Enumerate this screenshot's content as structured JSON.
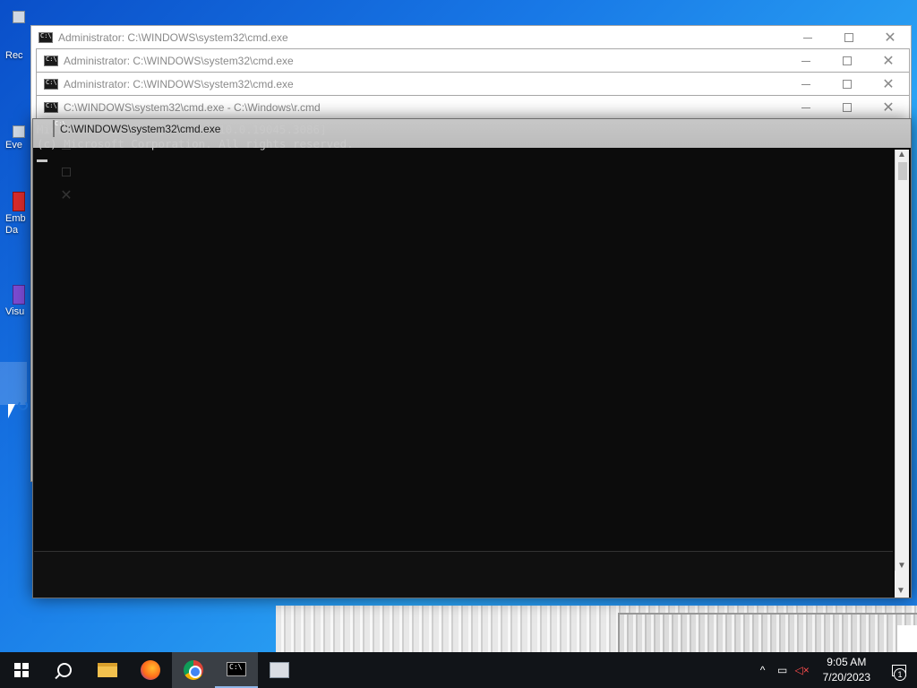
{
  "desktop": {
    "icons": [
      {
        "label": "Rec"
      },
      {
        "label": "Eve"
      },
      {
        "label": "Emb\nDa"
      },
      {
        "label": "Visu"
      }
    ]
  },
  "windows": [
    {
      "title": "Administrator: C:\\WINDOWS\\system32\\cmd.exe"
    },
    {
      "title": "Administrator: C:\\WINDOWS\\system32\\cmd.exe"
    },
    {
      "title": "Administrator: C:\\WINDOWS\\system32\\cmd.exe"
    },
    {
      "title": "C:\\WINDOWS\\system32\\cmd.exe - C:\\Windows\\r.cmd"
    }
  ],
  "main_window": {
    "title": "C:\\WINDOWS\\system32\\cmd.exe",
    "console_lines": "Microsoft Windows [Version 10.0.19045.3086]\n(c) Microsoft Corporation. All rights reserved."
  },
  "window_controls": {
    "minimize": "—",
    "maximize": "☐",
    "close": "✕"
  },
  "taskbar": {
    "apps": [
      "start-icon",
      "search-icon",
      "file-explorer-icon",
      "firefox-icon",
      "chrome-icon",
      "cmd-icon",
      "image-viewer-icon"
    ],
    "clock_time": "9:05 AM",
    "clock_date": "7/20/2023",
    "notification_count": "1"
  }
}
